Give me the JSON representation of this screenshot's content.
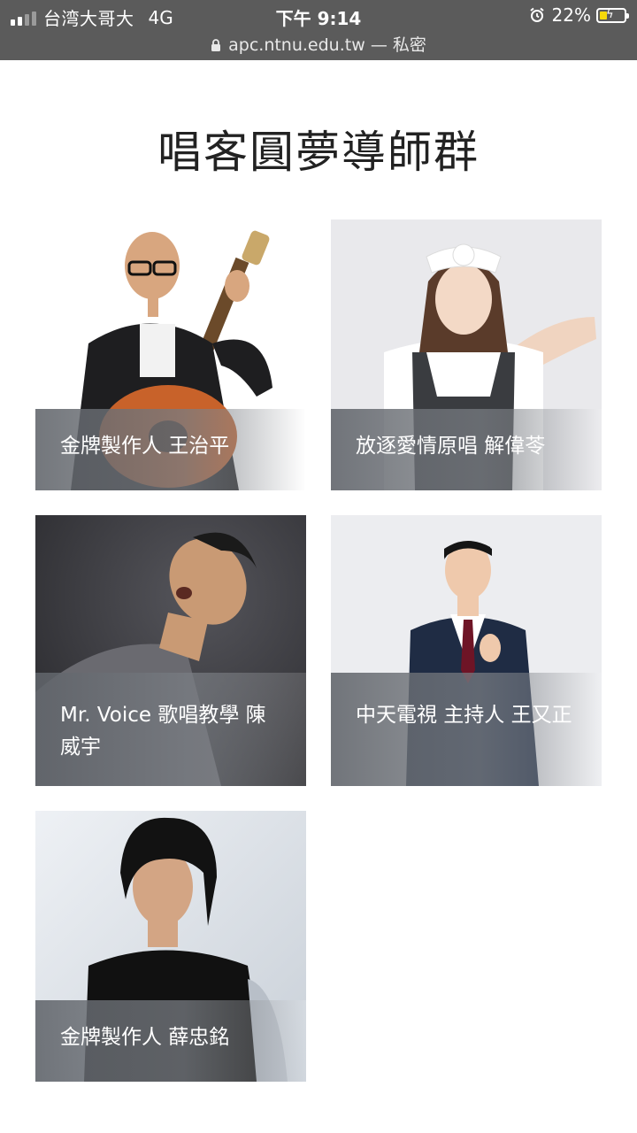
{
  "status_bar": {
    "carrier": "台湾大哥大",
    "network": "4G",
    "time": "下午 9:14",
    "battery_percent": "22%",
    "url": "apc.ntnu.edu.tw",
    "private_label": "— 私密",
    "battery_level": 0.22,
    "battery_color": "#f5d90a"
  },
  "page": {
    "title": "唱客圓夢導師群"
  },
  "mentors": [
    {
      "caption": "金牌製作人 王治平"
    },
    {
      "caption": "放逐愛情原唱  解偉苓"
    },
    {
      "caption": "Mr. Voice 歌唱教學  陳威宇"
    },
    {
      "caption": "中天電視 主持人  王又正"
    },
    {
      "caption": "金牌製作人 薛忠銘"
    }
  ]
}
